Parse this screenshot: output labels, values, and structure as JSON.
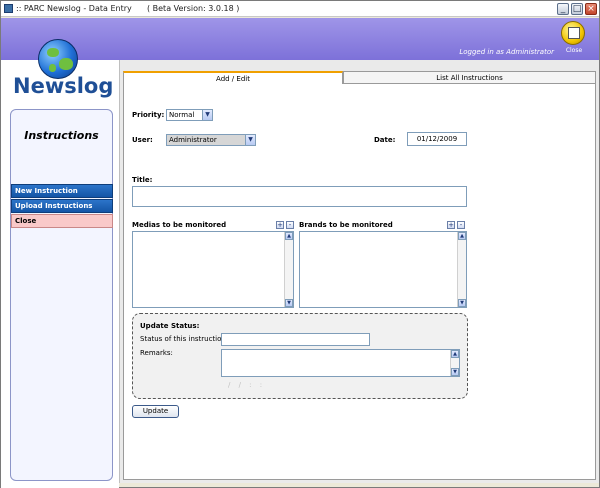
{
  "window": {
    "title": ":: PARC Newslog - Data Entry      ( Beta Version: 3.0.18 )"
  },
  "header": {
    "logged_in": "Logged in as Administrator",
    "close_label": "Close"
  },
  "brand": {
    "name": "Newslog"
  },
  "sidebar": {
    "title": "Instructions",
    "items": [
      {
        "label": "New Instruction"
      },
      {
        "label": "Upload Instructions"
      },
      {
        "label": "Close"
      }
    ]
  },
  "tabs": [
    {
      "label": "Add / Edit"
    },
    {
      "label": "List All Instructions"
    }
  ],
  "form": {
    "priority_label": "Priority:",
    "priority_value": "Normal",
    "user_label": "User:",
    "user_value": "Administrator",
    "date_label": "Date:",
    "date_value": "01/12/2009",
    "title_label": "Title:",
    "title_value": "",
    "medias_label": "Medias to be  monitored",
    "brands_label": "Brands to be  monitored",
    "plus": "+",
    "minus": "-",
    "update_status": {
      "heading": "Update Status:",
      "status_label": "Status of this instruction",
      "status_value": "",
      "remarks_label": "Remarks:",
      "remarks_value": "",
      "faint_date": "/ /    :  :"
    },
    "update_button": "Update"
  },
  "colors": {
    "header_bg": "#8f84e3",
    "nav_blue": "#1c63b8",
    "nav_close": "#f9c9c9",
    "tab_active_accent": "#f0a000",
    "brand_text": "#1f4f96"
  }
}
